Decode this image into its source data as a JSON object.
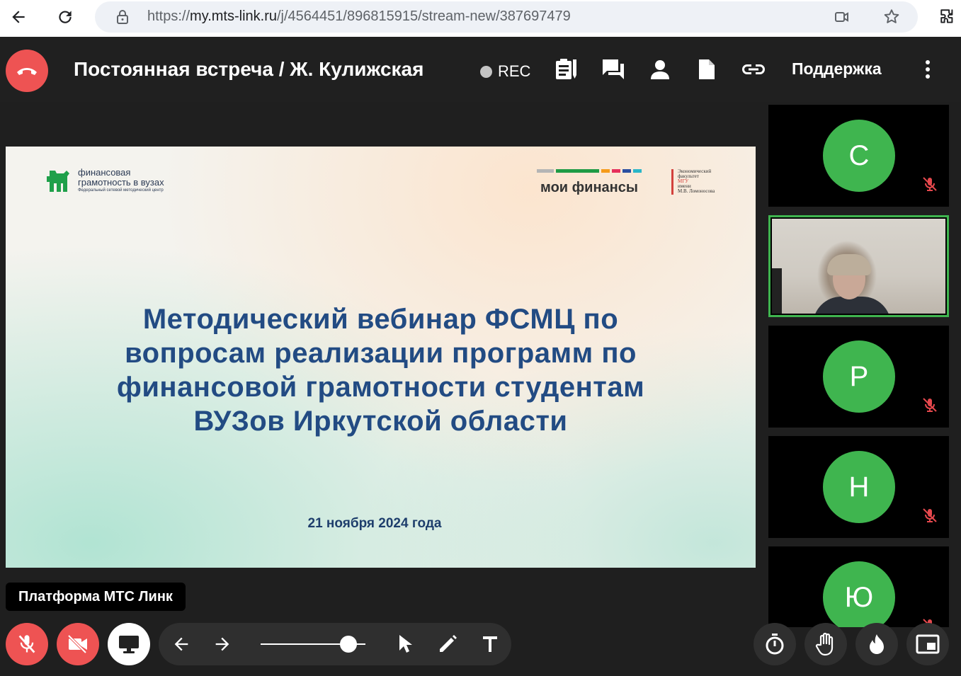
{
  "browser": {
    "url_prefix": "https://",
    "url_host": "my.mts-link.ru",
    "url_path": "/j/4564451/896815915/stream-new/387697479"
  },
  "meeting": {
    "title": "Постоянная встреча / Ж. Кулижская",
    "rec_label": "REC",
    "support_label": "Поддержка"
  },
  "slide": {
    "logo_left_line1": "финансовая",
    "logo_left_line2": "грамотность в вузах",
    "logo_left_line3": "Федеральный сетевой методический центр",
    "logo_center": "мои финансы",
    "logo_right_line1": "Экономический",
    "logo_right_line2": "факультет",
    "logo_right_line3": "МГУ",
    "logo_right_line4": "имени",
    "logo_right_line5": "М.В. Ломоносова",
    "title_line1": "Методический вебинар ФСМЦ по",
    "title_line2": "вопросам реализации программ по",
    "title_line3": "финансовой грамотности студентам",
    "title_line4": "ВУЗов Иркутской области",
    "date": "21 ноября 2024 года"
  },
  "participants": [
    {
      "initial": "С",
      "muted": true
    },
    {
      "initial": "",
      "muted": false,
      "video": true
    },
    {
      "initial": "Р",
      "muted": true
    },
    {
      "initial": "Н",
      "muted": true
    },
    {
      "initial": "Ю",
      "muted": true
    }
  ],
  "caption_label": "Платформа МТС Линк",
  "slider": {
    "value_fraction": 0.9
  },
  "colors": {
    "accent_green": "#3fb54f",
    "danger_red": "#ee5353",
    "slide_title": "#224b83",
    "background": "#1f1f1f"
  }
}
